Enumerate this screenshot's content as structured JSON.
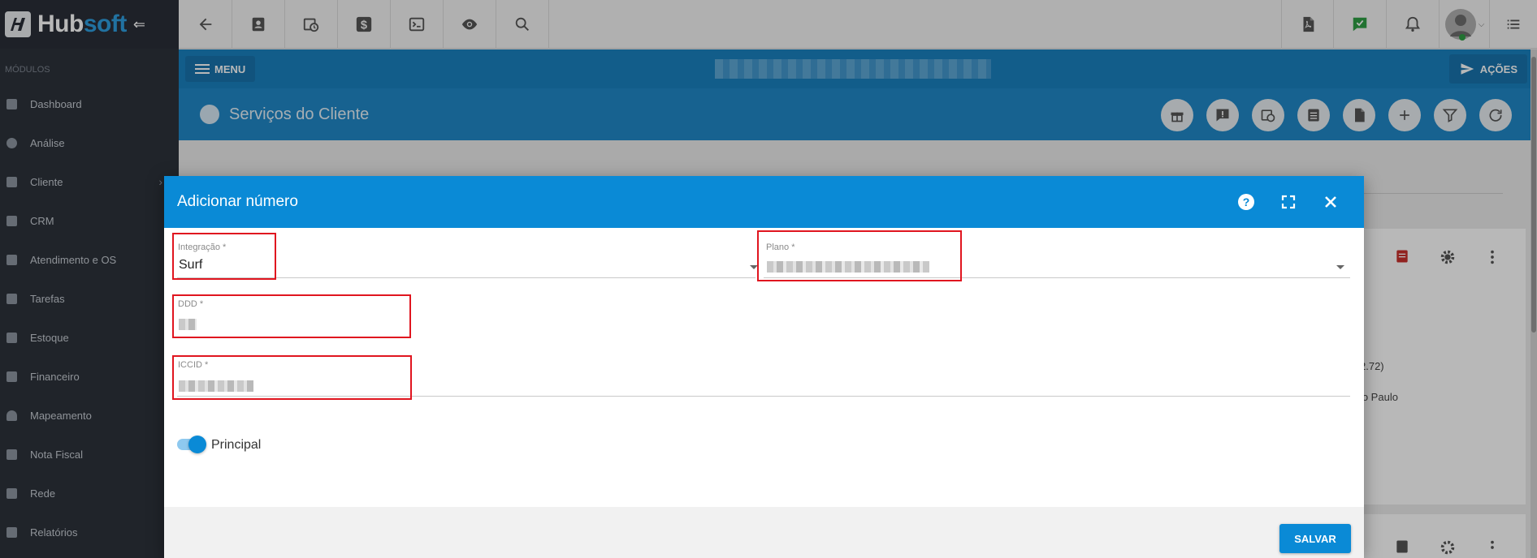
{
  "app": {
    "logo_part1": "Hub",
    "logo_part2": "soft",
    "collapse_glyph": "⇐"
  },
  "topbar": {
    "left_icons": [
      "back-arrow-icon",
      "contact-card-icon",
      "calendar-clock-icon",
      "dollar-icon",
      "terminal-icon",
      "eye-icon",
      "search-icon"
    ],
    "right_icons": [
      "pdf-icon",
      "check-message-icon",
      "bell-icon",
      "avatar",
      "list-icon"
    ]
  },
  "sidebar": {
    "section": "MÓDULOS",
    "items": [
      {
        "label": "Dashboard"
      },
      {
        "label": "Análise"
      },
      {
        "label": "Cliente",
        "chevron": "›"
      },
      {
        "label": "CRM"
      },
      {
        "label": "Atendimento e OS"
      },
      {
        "label": "Tarefas"
      },
      {
        "label": "Estoque"
      },
      {
        "label": "Financeiro"
      },
      {
        "label": "Mapeamento"
      },
      {
        "label": "Nota Fiscal"
      },
      {
        "label": "Rede"
      },
      {
        "label": "Relatórios"
      }
    ]
  },
  "menubar": {
    "menu_label": "MENU",
    "acoes_label": "AÇÕES"
  },
  "page": {
    "title": "Serviços do Cliente",
    "header_icons": [
      "gift-icon",
      "alert-message-icon",
      "calendar-clock-icon",
      "list-icon",
      "document-icon",
      "plus-icon",
      "filter-icon",
      "refresh-icon"
    ]
  },
  "background_text": {
    "fragment1": "2.72)",
    "fragment2": "eto Paulo"
  },
  "modal": {
    "title": "Adicionar número",
    "header_icons": [
      "help-icon",
      "fullscreen-icon",
      "close-icon"
    ],
    "fields": {
      "integracao": {
        "label": "Integração *",
        "value": "Surf"
      },
      "plano": {
        "label": "Plano *",
        "value": ""
      },
      "ddd": {
        "label": "DDD *",
        "value": ""
      },
      "iccid": {
        "label": "ICCID *",
        "value": ""
      }
    },
    "toggle": {
      "label": "Principal",
      "checked": true
    },
    "save_label": "SALVAR"
  },
  "colors": {
    "primary": "#0a8ad6",
    "sidebar_bg": "#2d323b",
    "highlight": "#e0151f"
  }
}
